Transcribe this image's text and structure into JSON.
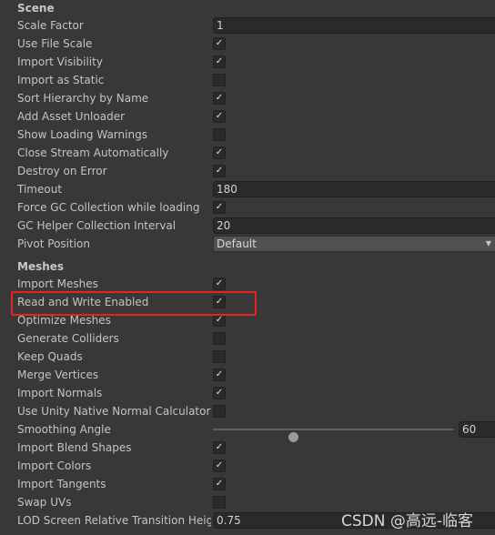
{
  "sections": [
    {
      "title": "Scene",
      "rows": [
        {
          "label": "Scale Factor",
          "type": "field",
          "value": "1"
        },
        {
          "label": "Use File Scale",
          "type": "checkbox",
          "checked": true
        },
        {
          "label": "Import Visibility",
          "type": "checkbox",
          "checked": true
        },
        {
          "label": "Import as Static",
          "type": "checkbox",
          "checked": false
        },
        {
          "label": "Sort Hierarchy by Name",
          "type": "checkbox",
          "checked": true
        },
        {
          "label": "Add Asset Unloader",
          "type": "checkbox",
          "checked": true
        },
        {
          "label": "Show Loading Warnings",
          "type": "checkbox",
          "checked": false
        },
        {
          "label": "Close Stream Automatically",
          "type": "checkbox",
          "checked": true
        },
        {
          "label": "Destroy on Error",
          "type": "checkbox",
          "checked": true
        },
        {
          "label": "Timeout",
          "type": "field",
          "value": "180"
        },
        {
          "label": "Force GC Collection while loading",
          "type": "checkbox",
          "checked": true
        },
        {
          "label": "GC Helper Collection Interval",
          "type": "field",
          "value": "20"
        },
        {
          "label": "Pivot Position",
          "type": "dropdown",
          "value": "Default"
        }
      ]
    },
    {
      "title": "Meshes",
      "rows": [
        {
          "label": "Import Meshes",
          "type": "checkbox",
          "checked": true
        },
        {
          "label": "Read and Write Enabled",
          "type": "checkbox",
          "checked": true,
          "highlighted": true
        },
        {
          "label": "Optimize Meshes",
          "type": "checkbox",
          "checked": true
        },
        {
          "label": "Generate Colliders",
          "type": "checkbox",
          "checked": false
        },
        {
          "label": "Keep Quads",
          "type": "checkbox",
          "checked": false
        },
        {
          "label": "Merge Vertices",
          "type": "checkbox",
          "checked": true
        },
        {
          "label": "Import Normals",
          "type": "checkbox",
          "checked": true
        },
        {
          "label": "Use Unity Native Normal Calculator",
          "type": "checkbox",
          "checked": false
        },
        {
          "label": "Smoothing Angle",
          "type": "slider",
          "value": "60",
          "min": 0,
          "max": 180
        },
        {
          "label": "Import Blend Shapes",
          "type": "checkbox",
          "checked": true
        },
        {
          "label": "Import Colors",
          "type": "checkbox",
          "checked": true
        },
        {
          "label": "Import Tangents",
          "type": "checkbox",
          "checked": true
        },
        {
          "label": "Swap UVs",
          "type": "checkbox",
          "checked": false
        },
        {
          "label": "LOD Screen Relative Transition Heigh",
          "type": "field",
          "value": "0.75"
        }
      ]
    }
  ],
  "check_glyph": "✓",
  "highlight_color": "#ec2020",
  "watermark": "CSDN @高远-临客"
}
